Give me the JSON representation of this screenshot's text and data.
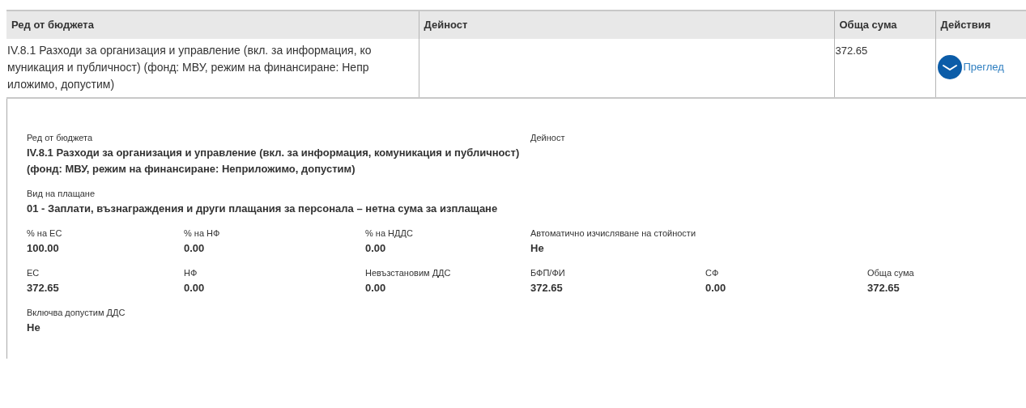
{
  "table": {
    "columns": [
      "Ред от бюджета",
      "Дейност",
      "Обща сума",
      "Действия"
    ],
    "rows": [
      {
        "cells": [
          "IV.8.1 Разходи за организация и управление (вкл. за информация, ко муникация и публичност) (фонд: МВУ, режим на финансиране: Непр иложимо, допустим)",
          "",
          "372.65"
        ],
        "action": "Преглед",
        "expanded": true
      }
    ]
  },
  "details": {
    "rows": [
      [
        {
          "label": "Ред от бюджета",
          "value": "IV.8.1 Разходи за организация и управление (вкл. за информация, комуникация и публичност) (фонд: МВУ, режим на финансиране: Неприложимо, допустим)"
        },
        "",
        "",
        {
          "label": "Дейност"
        }
      ],
      [
        {
          "label": "Вид на плащане",
          "value": "01 - Заплати, възнаграждения и други плащания за персонала – нетна сума за изплащане"
        },
        "",
        ""
      ],
      [
        {
          "label": "% на ЕС",
          "value": "100.00"
        },
        {
          "label": "% на НФ",
          "value": "0.00"
        },
        {
          "label": "% на НДДС",
          "value": "0.00"
        },
        {
          "label": "Автоматично изчисляване на стойности",
          "value": "Не"
        }
      ],
      [
        {
          "label": "ЕС",
          "value": "372.65"
        },
        {
          "label": "НФ",
          "value": "0.00"
        },
        {
          "label": "Невъзстановим ДДС",
          "value": "0.00"
        },
        {
          "label": "БФП/ФИ",
          "value": "372.65"
        },
        {
          "label": "СФ",
          "value": "0.00"
        },
        {
          "label": "Обща сума",
          "value": "372.65"
        }
      ],
      [
        {
          "label": "Включва допустим ДДС",
          "value": "Не"
        }
      ]
    ]
  }
}
